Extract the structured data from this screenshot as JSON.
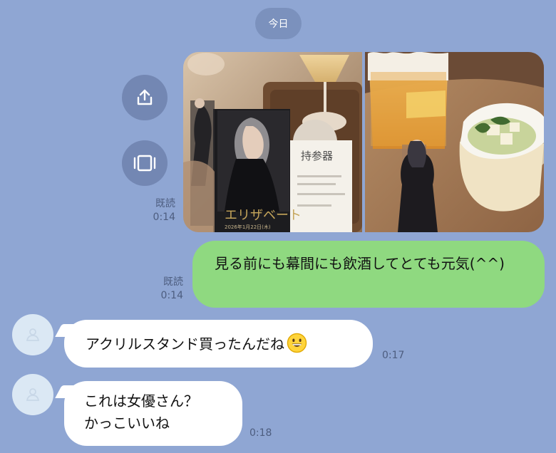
{
  "date_separator": "今日",
  "colors": {
    "background": "#8fa6d3",
    "outgoing_bubble": "#8fd980",
    "incoming_bubble": "#ffffff",
    "meta_text": "#4d5d7f"
  },
  "actions": {
    "share_icon": "share-icon",
    "viewer_icon": "album-viewer-icon"
  },
  "messages": {
    "photo_read": "既読",
    "photo_time": "0:14",
    "outgoing_text": "見る前にも幕間にも飲酒してとても元気(^^)",
    "outgoing_read": "既読",
    "outgoing_time": "0:14",
    "incoming_1_text": "アクリルスタンド買ったんだね",
    "incoming_1_emoji": "grinning-face-emoji",
    "incoming_1_time": "0:17",
    "incoming_2_text": "これは女優さん？\nかっこいいね",
    "incoming_2_time": "0:18"
  },
  "photos": {
    "program_title_text": "エリザベート",
    "ticket_heading": "持参器",
    "program_date": "2026年1月22日(木)"
  }
}
